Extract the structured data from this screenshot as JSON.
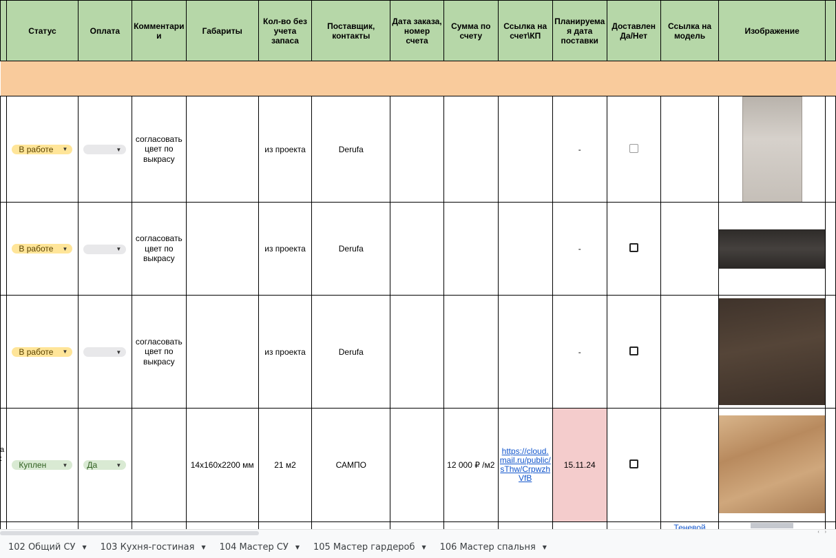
{
  "headers": {
    "status": "Статус",
    "payment": "Оплата",
    "comments": "Комментари и",
    "dimensions": "Габариты",
    "qty": "Кол-во без учета запаса",
    "supplier": "Поставщик, контакты",
    "order_date": "Дата заказа, номер счета",
    "sum": "Сумма по счету",
    "invoice_link": "Ссылка на счет\\КП",
    "planned_date": "Планируема я дата поставки",
    "delivered": "Доставлен Да/Нет",
    "model_link": "Ссылка на модель",
    "image": "Изображение"
  },
  "rows": [
    {
      "status": "В работе",
      "payment": "",
      "comment": "согласовать цвет по выкрасу",
      "dimensions": "",
      "qty": "из проекта",
      "supplier": "Derufa",
      "order_date": "",
      "sum": "",
      "invoice_link": "",
      "planned_date": "-",
      "delivered": false,
      "model_link": "",
      "image_color": "#c7c2bc"
    },
    {
      "status": "В работе",
      "payment": "",
      "comment": "согласовать цвет по выкрасу",
      "dimensions": "",
      "qty": "из проекта",
      "supplier": "Derufa",
      "order_date": "",
      "sum": "",
      "invoice_link": "",
      "planned_date": "-",
      "delivered": false,
      "model_link": "",
      "image_color": "#3a3633"
    },
    {
      "status": "В работе",
      "payment": "",
      "comment": "согласовать цвет по выкрасу",
      "dimensions": "",
      "qty": "из проекта",
      "supplier": "Derufa",
      "order_date": "",
      "sum": "",
      "invoice_link": "",
      "planned_date": "-",
      "delivered": false,
      "model_link": "",
      "image_color": "#47392f"
    },
    {
      "status": "Куплен",
      "payment": "Да",
      "comment": "",
      "dimensions": "14х160х2200 мм",
      "qty": "21 м2",
      "supplier": "САМПО",
      "order_date": "",
      "sum": "12 000 ₽ /м2",
      "invoice_link": "https://cloud.mail.ru/public/sThw/CrpwzhVfB",
      "invoice_link_lines": [
        "https://cloud.",
        "mail.ru/public/",
        "sThw/Crpwzh",
        "VfB"
      ],
      "planned_date": "15.11.24",
      "delivered": false,
      "model_link": "",
      "image_color": "#c49a6c"
    }
  ],
  "partial_row": {
    "model_link": "Теневой"
  },
  "left_cut_text": "a\n:",
  "status_colors": {
    "in_work": "#ffe599",
    "bought": "#d9ead3",
    "header_bg": "#b6d7a8",
    "band_bg": "#f9cb9c",
    "date_highlight": "#f4cccc"
  },
  "sheet_tabs": [
    {
      "label": "102 Общий СУ"
    },
    {
      "label": "103 Кухня-гостиная"
    },
    {
      "label": "104 Мастер СУ"
    },
    {
      "label": "105 Мастер гардероб"
    },
    {
      "label": "106 Мастер спальня"
    }
  ]
}
